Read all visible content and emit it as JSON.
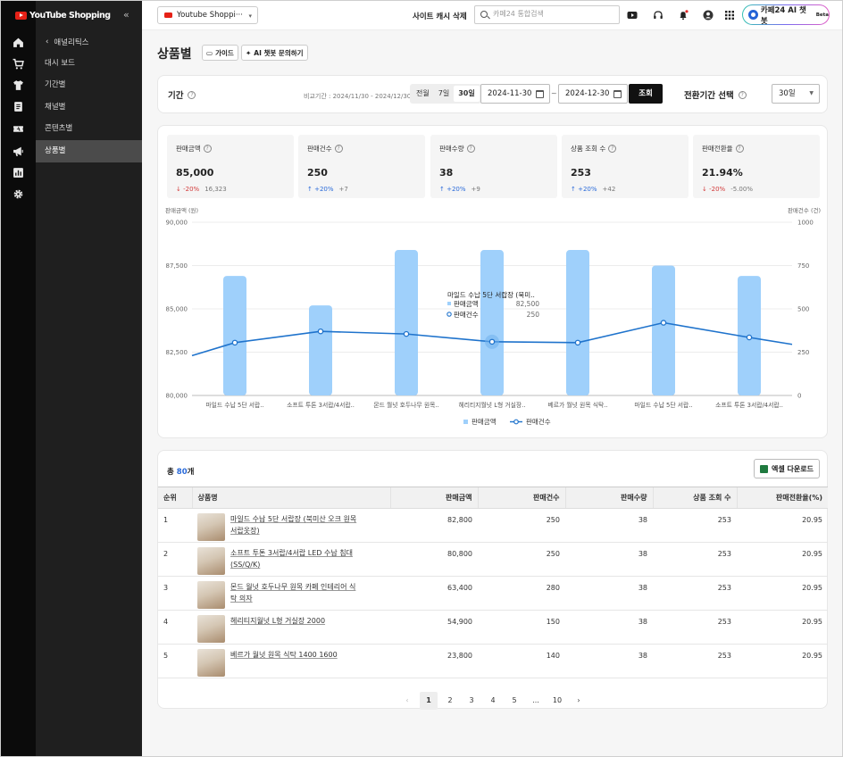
{
  "app": {
    "brand": "YouTube Shopping",
    "collapse_icon": "double-chevron-left-icon"
  },
  "rail_icons": [
    "home-icon",
    "cart-icon",
    "shirt-icon",
    "document-icon",
    "ticket-icon",
    "megaphone-icon",
    "bar-chart-icon",
    "gear-icon"
  ],
  "nav": {
    "back_label": "애널리틱스",
    "items": [
      {
        "label": "대시 보드",
        "active": false
      },
      {
        "label": "기간별",
        "active": false
      },
      {
        "label": "채널별",
        "active": false
      },
      {
        "label": "콘텐츠별",
        "active": false
      },
      {
        "label": "상품별",
        "active": true
      }
    ]
  },
  "topbar": {
    "shop_select": "Youtube Shoppi···",
    "cache_delete": "사이트 캐시 삭제",
    "search_placeholder": "카페24 통합검색",
    "icons": [
      "youtube-icon",
      "headset-icon",
      "bell-icon",
      "user-icon",
      "apps-grid-icon"
    ],
    "ai_label": "카페24 AI 챗봇",
    "ai_badge": "Beta"
  },
  "page": {
    "title": "상품별",
    "guide_label": "가이드",
    "ai_ask_label": "AI 챗봇 문의하기"
  },
  "filters": {
    "period_label": "기간",
    "compare_text": "비교기간 : 2024/11/30 - 2024/12/30",
    "presets": [
      "전월",
      "7일",
      "30일"
    ],
    "active_preset": "30일",
    "start_date": "2024-11-30",
    "end_date": "2024-12-30",
    "tilde": "~",
    "search_button": "조회",
    "conversion_label": "전환기간 선택",
    "conversion_value": "30일"
  },
  "kpis": [
    {
      "label": "판매금액",
      "value": "85,000",
      "change": "-20%",
      "direction": "down",
      "abs": "16,323"
    },
    {
      "label": "판매건수",
      "value": "250",
      "change": "+20%",
      "direction": "up",
      "abs": "+7"
    },
    {
      "label": "판매수량",
      "value": "38",
      "change": "+20%",
      "direction": "up",
      "abs": "+9"
    },
    {
      "label": "상품 조회 수",
      "value": "253",
      "change": "+20%",
      "direction": "up",
      "abs": "+42"
    },
    {
      "label": "판매전환율",
      "value": "21.94%",
      "change": "-20%",
      "direction": "down",
      "abs": "-5.00%"
    }
  ],
  "chart_data": {
    "type": "bar",
    "categories": [
      "마일드 수납 5단 서랍..",
      "소프트 투톤 3서랍/4서랍..",
      "몬드 월넛 호두나무 원목..",
      "헤리티지월넛 L형 거실장..",
      "베르가 월넛 원목 식탁..",
      "마일드 수납 5단 서랍..",
      "소프트 투톤 3서랍/4서랍.."
    ],
    "series": [
      {
        "name": "판매금액",
        "axis": "left",
        "kind": "bar",
        "values": [
          86900,
          85200,
          88400,
          88400,
          88400,
          87500,
          86900
        ]
      },
      {
        "name": "판매건수",
        "axis": "right",
        "kind": "line",
        "values": [
          305,
          370,
          355,
          310,
          305,
          420,
          335
        ]
      }
    ],
    "line_edge_values": [
      230,
      295
    ],
    "ylabel_left": "판매금액 (원)",
    "ylabel_right": "판매건수 (건)",
    "ylim_left": [
      80000,
      90000
    ],
    "yticks_left": [
      "80,000",
      "82,500",
      "85,000",
      "87,500",
      "90,000"
    ],
    "ylim_right": [
      0,
      1000
    ],
    "yticks_right": [
      "0",
      "250",
      "500",
      "750",
      "1000"
    ],
    "legend": {
      "placement": "bottom-center",
      "items": [
        "판매금액",
        "판매건수"
      ]
    },
    "grid": true,
    "bar_color": "#9fd0fb",
    "line_color": "#1f73cc",
    "tooltip": {
      "category_index": 3,
      "title": "마일드 수납 5단 서랍장 (북미..",
      "rows": [
        {
          "label": "판매금액",
          "value": "82,500"
        },
        {
          "label": "판매건수",
          "value": "250"
        }
      ]
    }
  },
  "table": {
    "total_prefix": "총",
    "total_count": "80",
    "total_suffix": "개",
    "excel_button": "엑셀 다운로드",
    "columns": [
      "순위",
      "상품명",
      "판매금액",
      "판매건수",
      "판매수량",
      "상품 조회 수",
      "판매전환율(%)"
    ],
    "rows": [
      {
        "rank": "1",
        "name": "마일드 수납 5단 서랍장 (북미산 오크 원목 서랍옷장)",
        "amount": "82,800",
        "count": "250",
        "qty": "38",
        "views": "253",
        "rate": "20.95"
      },
      {
        "rank": "2",
        "name": "소프트 투톤 3서랍/4서랍 LED 수납 침대 (SS/Q/K)",
        "amount": "80,800",
        "count": "250",
        "qty": "38",
        "views": "253",
        "rate": "20.95"
      },
      {
        "rank": "3",
        "name": "몬드 월넛 호두나무 원목 카페 인테리어 식탁 의자",
        "amount": "63,400",
        "count": "280",
        "qty": "38",
        "views": "253",
        "rate": "20.95"
      },
      {
        "rank": "4",
        "name": "헤리티지월넛 L형 거실장 2000",
        "amount": "54,900",
        "count": "150",
        "qty": "38",
        "views": "253",
        "rate": "20.95"
      },
      {
        "rank": "5",
        "name": "베르가 월넛 원목 식탁 1400 1600",
        "amount": "23,800",
        "count": "140",
        "qty": "38",
        "views": "253",
        "rate": "20.95"
      }
    ]
  },
  "pagination": {
    "prev": "‹",
    "pages": [
      "1",
      "2",
      "3",
      "4",
      "5",
      "...",
      "10"
    ],
    "current": "1",
    "next": "›"
  },
  "colors": {
    "accent": "#2a6ad9",
    "down": "#d23a3a",
    "sidebar": "#1f1f1f",
    "rail": "#0b0b0b"
  }
}
